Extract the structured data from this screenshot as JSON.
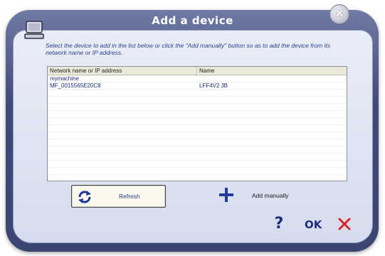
{
  "window": {
    "title": "Add a device",
    "close_glyph": "✕"
  },
  "instructions": "Select the device to add in the list below or click the \"Add manually\" button so as to add the device from its network name or IP address.",
  "device_list": {
    "columns": [
      "Network name or IP address",
      "Name"
    ],
    "rows": [
      {
        "address": "mymachine",
        "name": ""
      },
      {
        "address": "MF_0015565E20C8",
        "name": "LFF4V2 JB"
      }
    ]
  },
  "buttons": {
    "refresh_label": "Refresh",
    "add_manually_label": "Add manually",
    "help_label": "?",
    "ok_label": "OK"
  },
  "icons": {
    "window": "monitor-icon",
    "close": "close-icon",
    "refresh": "refresh-icon",
    "add": "plus-icon",
    "cancel": "red-x-icon"
  },
  "colors": {
    "frame": "#3f4a78",
    "panel": "#e2e7f3",
    "text_blue": "#1f2e7c",
    "cancel_red": "#d62424",
    "add_blue": "#243a9a"
  }
}
